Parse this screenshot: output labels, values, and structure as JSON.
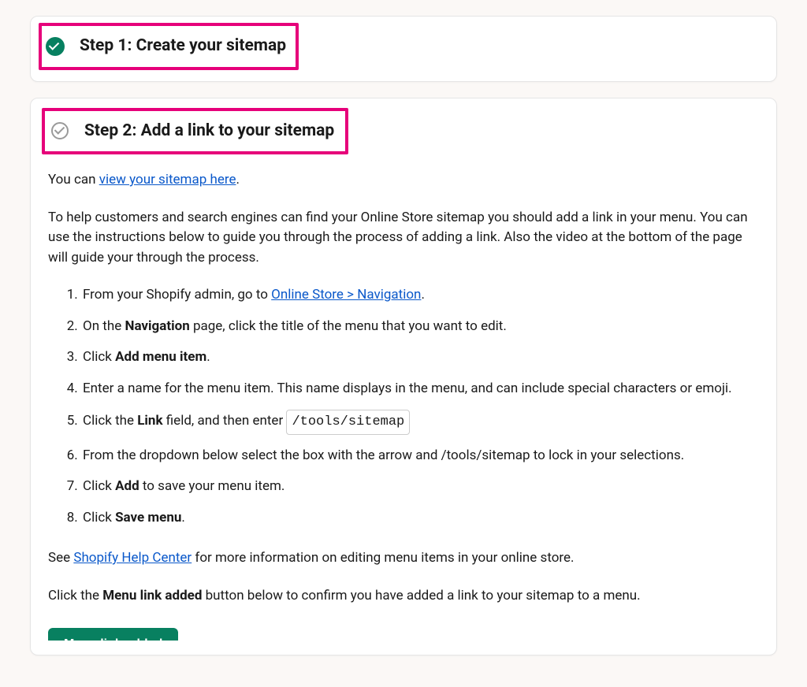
{
  "step1": {
    "title": "Step 1: Create your sitemap"
  },
  "step2": {
    "title": "Step 2: Add a link to your sitemap",
    "intro_prefix": "You can ",
    "intro_link": "view your sitemap here",
    "intro_suffix": ".",
    "paragraph": "To help customers and search engines can find your Online Store sitemap you should add a link in your menu. You can use the instructions below to guide you through the process of adding a link. Also the video at the bottom of the page will guide your through the process.",
    "items": {
      "i1_a": "From your Shopify admin, go to ",
      "i1_link": "Online Store > Navigation",
      "i1_b": ".",
      "i2_a": "On the ",
      "i2_bold": "Navigation",
      "i2_b": " page, click the title of the menu that you want to edit.",
      "i3_a": "Click ",
      "i3_bold": "Add menu item",
      "i3_b": ".",
      "i4": "Enter a name for the menu item. This name displays in the menu, and can include special characters or emoji.",
      "i5_a": "Click the ",
      "i5_bold": "Link",
      "i5_b": " field, and then enter ",
      "i5_code": "/tools/sitemap",
      "i6": "From the dropdown below select the box with the arrow and /tools/sitemap to lock in your selections.",
      "i7_a": "Click ",
      "i7_bold": "Add",
      "i7_b": " to save your menu item.",
      "i8_a": "Click ",
      "i8_bold": "Save menu",
      "i8_b": "."
    },
    "see_prefix": "See ",
    "see_link": "Shopify Help Center",
    "see_suffix": " for more information on editing menu items in your online store.",
    "cta_a": "Click the ",
    "cta_bold": "Menu link added",
    "cta_b": " button below to confirm you have added a link to your sitemap to a menu.",
    "button": "Menu link added"
  }
}
